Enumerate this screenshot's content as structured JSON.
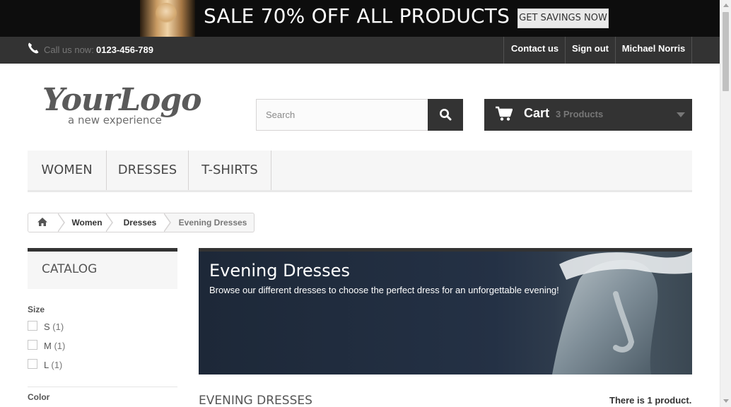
{
  "promo": {
    "text": "SALE 70% OFF ALL PRODUCTS",
    "button_label": "GET SAVINGS NOW"
  },
  "topbar": {
    "call_label": "Call us now:",
    "phone_number": "0123-456-789",
    "nav": {
      "contact": "Contact us",
      "signout": "Sign out",
      "user": "Michael Norris"
    }
  },
  "logo": {
    "main": "YourLogo",
    "tagline": "a new experience"
  },
  "search": {
    "placeholder": "Search",
    "icon": "search-icon"
  },
  "cart": {
    "label": "Cart",
    "count": "3 Products",
    "icon": "cart-icon"
  },
  "menu": {
    "items": [
      "WOMEN",
      "DRESSES",
      "T-SHIRTS"
    ]
  },
  "breadcrumb": {
    "home_icon": "home-icon",
    "items": [
      "Women",
      "Dresses"
    ],
    "current": "Evening Dresses"
  },
  "sidebar": {
    "catalog_title": "CATALOG",
    "filters": {
      "size_title": "Size",
      "sizes": [
        {
          "label": "S",
          "count": "(1)"
        },
        {
          "label": "M",
          "count": "(1)"
        },
        {
          "label": "L",
          "count": "(1)"
        }
      ],
      "color_title": "Color"
    }
  },
  "category": {
    "title": "Evening Dresses",
    "description": "Browse our different dresses to choose the perfect dress for an unforgettable evening!",
    "heading": "EVENING DRESSES",
    "product_count_prefix": "There is",
    "product_count_num": "1",
    "product_count_suffix": "product."
  },
  "colors": {
    "dark": "#333333",
    "menu_bg": "#f6f6f6",
    "banner_bg": "#243145"
  }
}
